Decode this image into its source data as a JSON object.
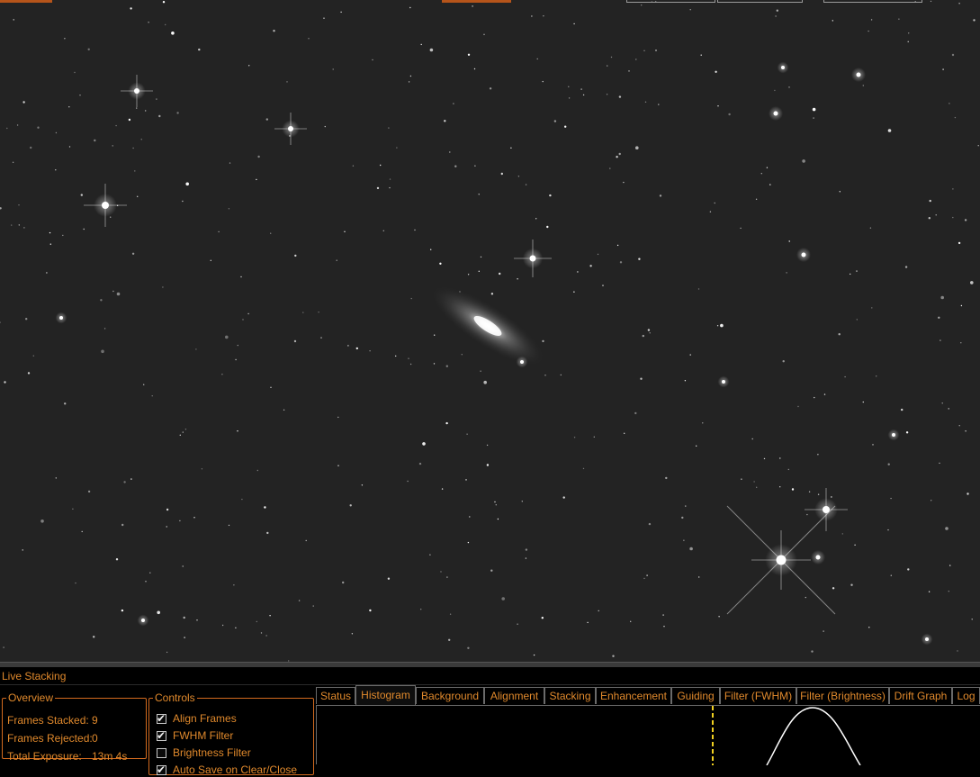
{
  "window": {
    "panel_title": "Live Stacking"
  },
  "overview": {
    "legend": "Overview",
    "frames_stacked_label": "Frames Stacked:",
    "frames_stacked_value": "9",
    "frames_rejected_label": "Frames Rejected:",
    "frames_rejected_value": "0",
    "total_exposure_label": "Total Exposure:",
    "total_exposure_value": "13m 4s"
  },
  "controls": {
    "legend": "Controls",
    "items": [
      {
        "label": "Align Frames",
        "checked": true
      },
      {
        "label": "FWHM Filter",
        "checked": true
      },
      {
        "label": "Brightness Filter",
        "checked": false
      },
      {
        "label": "Auto Save on Clear/Close",
        "checked": true
      }
    ]
  },
  "tabs": {
    "items": [
      "Status",
      "Histogram",
      "Background",
      "Alignment",
      "Stacking",
      "Enhancement",
      "Guiding",
      "Filter (FWHM)",
      "Filter (Brightness)",
      "Drift Graph",
      "Log"
    ],
    "active": "Histogram"
  },
  "colors": {
    "accent": "#e0892c",
    "frame_border": "#d26a1e",
    "sky_background": "#232323",
    "histogram_marker": "#f0d020",
    "histogram_curve": "#ffffff"
  },
  "histogram": {
    "marker": "dashed yellow vertical line",
    "curve": "white bell curve"
  }
}
